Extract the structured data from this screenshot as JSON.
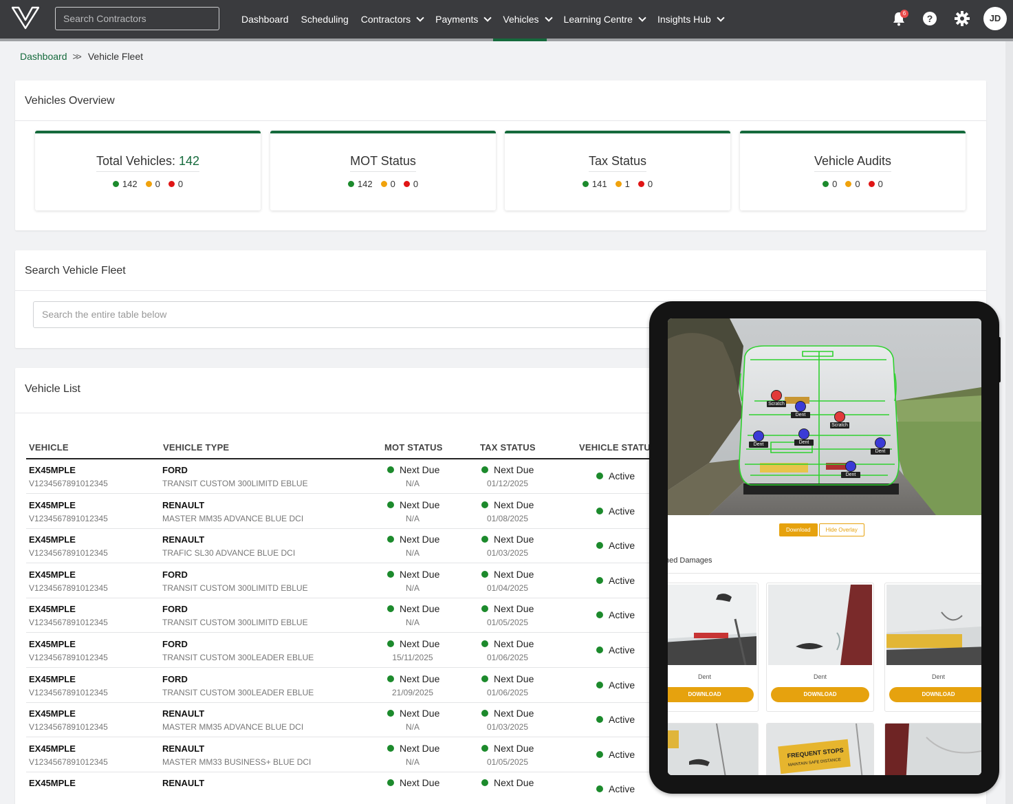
{
  "nav": {
    "search_placeholder": "Search Contractors",
    "items": [
      {
        "label": "Dashboard",
        "dropdown": false
      },
      {
        "label": "Scheduling",
        "dropdown": false
      },
      {
        "label": "Contractors",
        "dropdown": true
      },
      {
        "label": "Payments",
        "dropdown": true
      },
      {
        "label": "Vehicles",
        "dropdown": true,
        "active": true
      },
      {
        "label": "Learning Centre",
        "dropdown": true
      },
      {
        "label": "Insights Hub",
        "dropdown": true
      }
    ],
    "notification_count": "6",
    "help_label": "?",
    "avatar_initials": "JD",
    "accent_color": "#156a3c"
  },
  "breadcrumb": {
    "home": "Dashboard",
    "current": "Vehicle Fleet"
  },
  "overview": {
    "title": "Vehicles Overview",
    "stats": [
      {
        "title": "Total Vehicles: ",
        "title_num": "142",
        "green": "142",
        "amber": "0",
        "red": "0"
      },
      {
        "title": "MOT Status",
        "title_num": "",
        "green": "142",
        "amber": "0",
        "red": "0"
      },
      {
        "title": "Tax Status",
        "title_num": "",
        "green": "141",
        "amber": "1",
        "red": "0"
      },
      {
        "title": "Vehicle Audits",
        "title_num": "",
        "green": "0",
        "amber": "0",
        "red": "0"
      }
    ]
  },
  "search": {
    "title": "Search Vehicle Fleet",
    "placeholder": "Search the entire table below"
  },
  "vehicle_list": {
    "title": "Vehicle List",
    "columns": [
      "VEHICLE",
      "VEHICLE TYPE",
      "MOT STATUS",
      "TAX STATUS",
      "VEHICLE STATUS"
    ],
    "rows": [
      {
        "reg": "EX45MPLE",
        "vin": "V1234567891012345",
        "make": "FORD",
        "model": "TRANSIT CUSTOM 300LIMITD EBLUE",
        "mot": "Next Due",
        "mot_date": "N/A",
        "tax": "Next Due",
        "tax_date": "01/12/2025",
        "status": "Active"
      },
      {
        "reg": "EX45MPLE",
        "vin": "V1234567891012345",
        "make": "RENAULT",
        "model": "MASTER MM35 ADVANCE BLUE DCI",
        "mot": "Next Due",
        "mot_date": "N/A",
        "tax": "Next Due",
        "tax_date": "01/08/2025",
        "status": "Active"
      },
      {
        "reg": "EX45MPLE",
        "vin": "V1234567891012345",
        "make": "RENAULT",
        "model": "TRAFIC SL30 ADVANCE BLUE DCI",
        "mot": "Next Due",
        "mot_date": "N/A",
        "tax": "Next Due",
        "tax_date": "01/03/2025",
        "status": "Active"
      },
      {
        "reg": "EX45MPLE",
        "vin": "V1234567891012345",
        "make": "FORD",
        "model": "TRANSIT CUSTOM 300LIMITD EBLUE",
        "mot": "Next Due",
        "mot_date": "N/A",
        "tax": "Next Due",
        "tax_date": "01/04/2025",
        "status": "Active"
      },
      {
        "reg": "EX45MPLE",
        "vin": "V1234567891012345",
        "make": "FORD",
        "model": "TRANSIT CUSTOM 300LIMITD EBLUE",
        "mot": "Next Due",
        "mot_date": "N/A",
        "tax": "Next Due",
        "tax_date": "01/05/2025",
        "status": "Active"
      },
      {
        "reg": "EX45MPLE",
        "vin": "V1234567891012345",
        "make": "FORD",
        "model": "TRANSIT CUSTOM 300LEADER EBLUE",
        "mot": "Next Due",
        "mot_date": "15/11/2025",
        "tax": "Next Due",
        "tax_date": "01/06/2025",
        "status": "Active"
      },
      {
        "reg": "EX45MPLE",
        "vin": "V1234567891012345",
        "make": "FORD",
        "model": "TRANSIT CUSTOM 300LEADER EBLUE",
        "mot": "Next Due",
        "mot_date": "21/09/2025",
        "tax": "Next Due",
        "tax_date": "01/06/2025",
        "status": "Active"
      },
      {
        "reg": "EX45MPLE",
        "vin": "V1234567891012345",
        "make": "RENAULT",
        "model": "MASTER MM35 ADVANCE BLUE DCI",
        "mot": "Next Due",
        "mot_date": "N/A",
        "tax": "Next Due",
        "tax_date": "01/03/2025",
        "status": "Active"
      },
      {
        "reg": "EX45MPLE",
        "vin": "V1234567891012345",
        "make": "RENAULT",
        "model": "MASTER MM33 BUSINESS+ BLUE DCI",
        "mot": "Next Due",
        "mot_date": "N/A",
        "tax": "Next Due",
        "tax_date": "01/05/2025",
        "status": "Active"
      },
      {
        "reg": "EX45MPLE",
        "vin": "",
        "make": "RENAULT",
        "model": "",
        "mot": "Next Due",
        "mot_date": "",
        "tax": "Next Due",
        "tax_date": "",
        "status": "Active"
      }
    ]
  },
  "tablet": {
    "markers": [
      {
        "label": "Scratch",
        "color": "red"
      },
      {
        "label": "Dent",
        "color": "blue"
      },
      {
        "label": "Scratch",
        "color": "red"
      },
      {
        "label": "Dent",
        "color": "blue"
      },
      {
        "label": "Dent",
        "color": "blue"
      },
      {
        "label": "Dent",
        "color": "blue"
      },
      {
        "label": "Dent",
        "color": "blue"
      }
    ],
    "download_label": "Download",
    "hide_overlay_label": "Hide Overlay",
    "damages_heading": "hed Damages",
    "damage_cards": [
      {
        "label": "Dent",
        "button": "DOWNLOAD"
      },
      {
        "label": "Dent",
        "button": "DOWNLOAD"
      },
      {
        "label": "Dent",
        "button": "DOWNLOAD"
      }
    ],
    "sticker_text_1": "FREQUENT STOPS",
    "sticker_text_2": "MAINTAIN SAFE DISTANCE"
  }
}
